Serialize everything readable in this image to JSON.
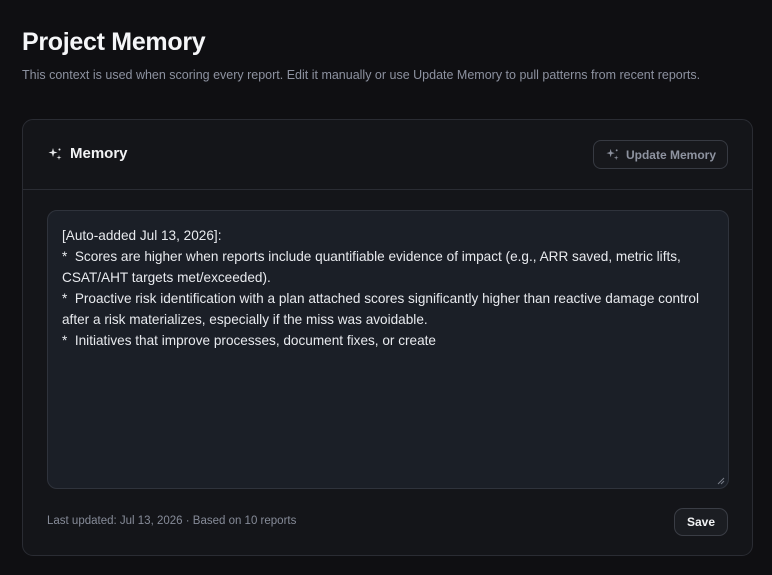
{
  "page": {
    "title": "Project Memory",
    "subtitle": "This context is used when scoring every report. Edit it manually or use Update Memory to pull patterns from recent reports."
  },
  "memory_card": {
    "title": "Memory",
    "title_icon": "sparkle-icon",
    "update_button": {
      "label": "Update Memory",
      "icon": "sparkle-icon"
    },
    "textarea_value": "[Auto-added Jul 13, 2026]:\n*  Scores are higher when reports include quantifiable evidence of impact (e.g., ARR saved, metric lifts, CSAT/AHT targets met/exceeded).\n*  Proactive risk identification with a plan attached scores significantly higher than reactive damage control after a risk materializes, especially if the miss was avoidable.\n*  Initiatives that improve processes, document fixes, or create",
    "last_updated": "Last updated: Jul 13, 2026 · Based on 10 reports",
    "save_label": "Save"
  },
  "colors": {
    "background": "#0f0f12",
    "card": "#141519",
    "textarea": "#1b1f27",
    "muted_text": "#8d92a0"
  }
}
